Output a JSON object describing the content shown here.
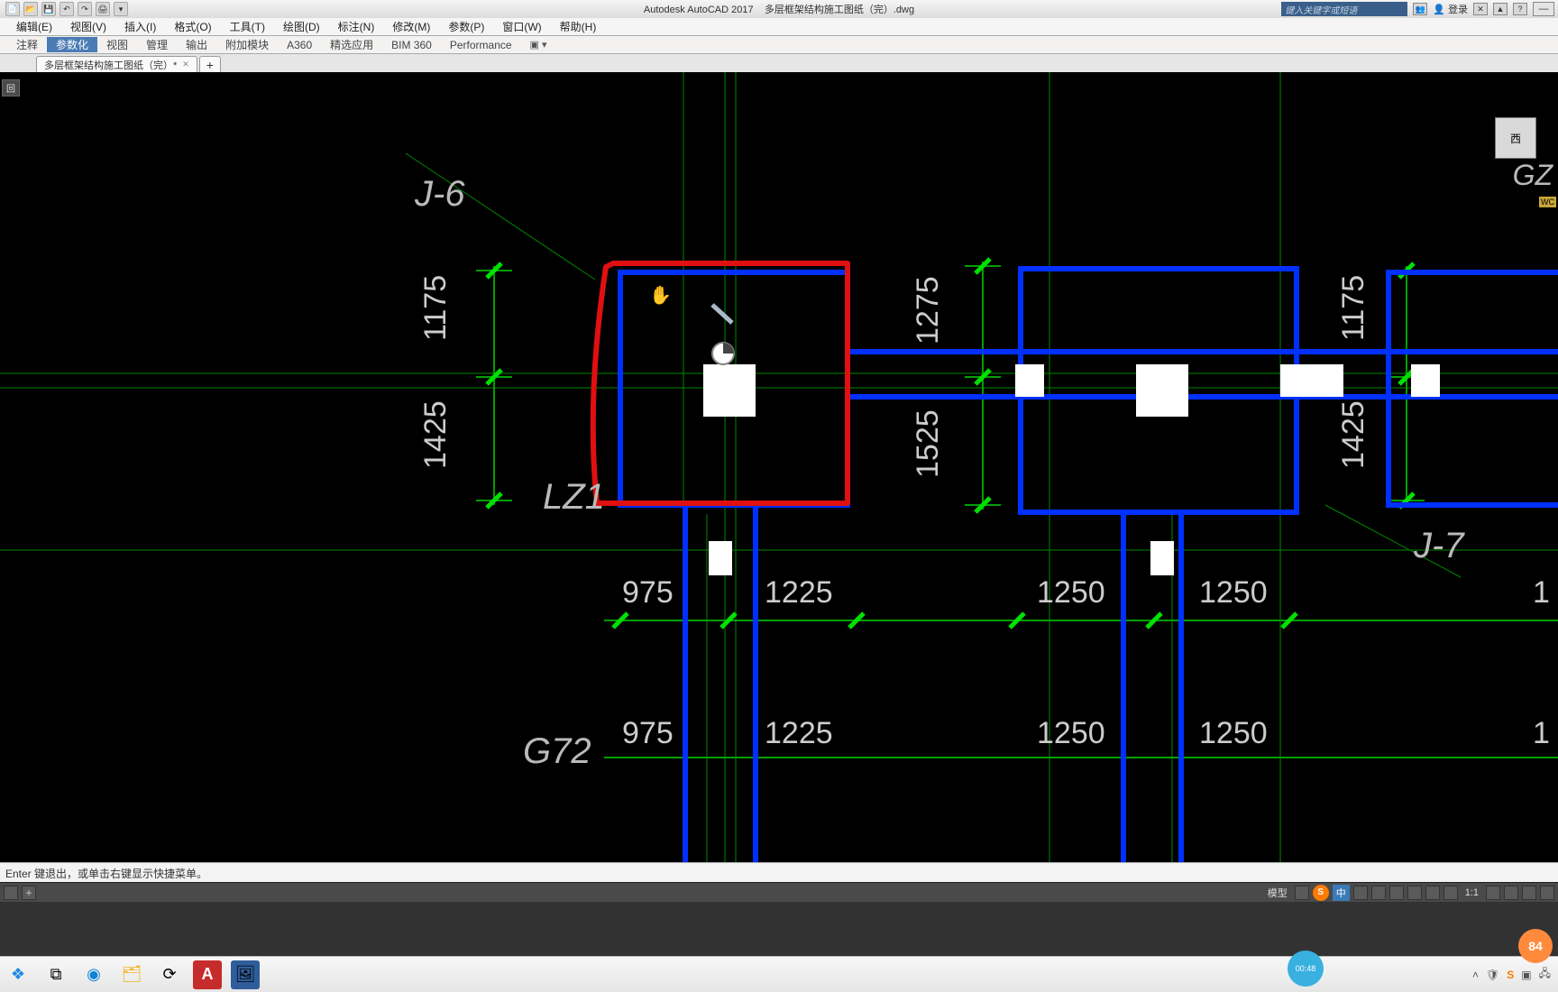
{
  "titlebar": {
    "app": "Autodesk AutoCAD 2017",
    "doc": "多层框架结构施工图纸（完）.dwg",
    "search_placeholder": "键入关键字或短语",
    "login": "登录"
  },
  "menu": [
    "编辑(E)",
    "视图(V)",
    "插入(I)",
    "格式(O)",
    "工具(T)",
    "绘图(D)",
    "标注(N)",
    "修改(M)",
    "参数(P)",
    "窗口(W)",
    "帮助(H)"
  ],
  "ribbon": [
    "注释",
    "参数化",
    "视图",
    "管理",
    "输出",
    "附加模块",
    "A360",
    "精选应用",
    "BIM 360",
    "Performance"
  ],
  "ribbon_active_index": 1,
  "file_tab": {
    "name": "多层框架结构施工图纸（完）*",
    "badge": "回"
  },
  "viewport": {
    "labels": {
      "J6": "J-6",
      "J7": "J-7",
      "LZ1": "LZ1",
      "GZ": "GZ",
      "GZ2_partial": "G72",
      "west": "西",
      "wcs": "WC"
    },
    "dims_vertical_left": [
      "1175",
      "1425"
    ],
    "dims_vertical_mid": [
      "1275",
      "1525"
    ],
    "dims_vertical_right": [
      "1175",
      "1425"
    ],
    "dims_row1": [
      "975",
      "1225",
      "1250",
      "1250"
    ],
    "dims_row2": [
      "975",
      "1225",
      "1250",
      "1250"
    ]
  },
  "cmdline": "Enter 键退出，或单击右键显示快捷菜单。",
  "statusbar": {
    "model": "模型",
    "sogou": "S",
    "ime": "中",
    "scale": "1:1",
    "plus": "+"
  },
  "taskbar": {
    "clock": "00:48",
    "score": "84"
  }
}
